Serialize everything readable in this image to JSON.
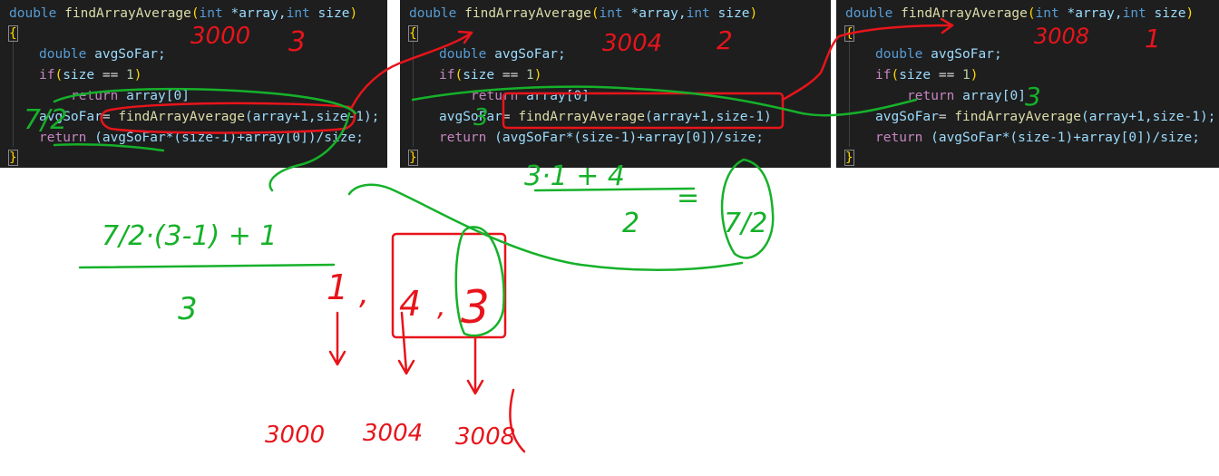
{
  "panels": [
    {
      "lines": {
        "signature": {
          "ret_type": "double",
          "fn_name": "findArrayAverage",
          "open_paren": "(",
          "p1_type": "int",
          "p1_name": " *array,",
          "p2_type": "int",
          "p2_name": " size",
          "close_paren": ")"
        },
        "open_brace": "{",
        "decl": {
          "type": "double",
          "name": " avgSoFar;"
        },
        "if_line": {
          "kw": "if",
          "open": "(",
          "var": "size",
          "op": " == ",
          "num": "1",
          "close": ")"
        },
        "return_base": {
          "kw": "return",
          "text": " array[0]"
        },
        "assign": {
          "lhs": "avgSoFar",
          "eq": "= ",
          "fn": "findArrayAverage",
          "args": "(array+1,size-1);"
        },
        "return_final": {
          "kw": "return",
          "text": " (avgSoFar*(size-1)+array[0])/size;"
        },
        "close_brace": "}"
      }
    },
    {
      "lines": {
        "signature": {
          "ret_type": "double",
          "fn_name": "findArrayAverage",
          "open_paren": "(",
          "p1_type": "int",
          "p1_name": " *array,",
          "p2_type": "int",
          "p2_name": " size",
          "close_paren": ")"
        },
        "open_brace": "{",
        "decl": {
          "type": "double",
          "name": " avgSoFar;"
        },
        "if_line": {
          "kw": "if",
          "open": "(",
          "var": "size",
          "op": " == ",
          "num": "1",
          "close": ")"
        },
        "return_base": {
          "kw": "return",
          "text": " array[0]"
        },
        "assign": {
          "lhs": "avgSoFar",
          "eq": "= ",
          "fn": "findArrayAverage",
          "args": "(array+1,size-1)"
        },
        "return_final": {
          "kw": "return",
          "text": " (avgSoFar*(size-1)+array[0])/size;"
        },
        "close_brace": "}"
      }
    },
    {
      "lines": {
        "signature": {
          "ret_type": "double",
          "fn_name": "findArrayAverage",
          "open_paren": "(",
          "p1_type": "int",
          "p1_name": " *array,",
          "p2_type": "int",
          "p2_name": " size",
          "close_paren": ")"
        },
        "open_brace": "{",
        "decl": {
          "type": "double",
          "name": " avgSoFar;"
        },
        "if_line": {
          "kw": "if",
          "open": "(",
          "var": "size",
          "op": " == ",
          "num": "1",
          "close": ")"
        },
        "return_base": {
          "kw": "return",
          "text": " array[0]"
        },
        "assign": {
          "lhs": "avgSoFar",
          "eq": "= ",
          "fn": "findArrayAverage",
          "args": "(array+1,size-1);"
        },
        "return_final": {
          "kw": "return",
          "text": " (avgSoFar*(size-1)+array[0])/size;"
        },
        "close_brace": "}"
      }
    }
  ],
  "annotations": {
    "colors": {
      "red": "#e8141b",
      "green": "#16b12a"
    },
    "panel1_address": "3000",
    "panel1_size": "3",
    "panel1_result": "7/2",
    "panel2_address": "3004",
    "panel2_size": "2",
    "panel2_result": "3",
    "panel3_address": "3008",
    "panel3_size": "1",
    "panel3_return": "3",
    "formula_left": {
      "num": "7/2·(3-1) + 1",
      "den": "3"
    },
    "formula_right": {
      "num": "3·1 + 4",
      "den": "2",
      "eq": "=",
      "result": "7/2"
    },
    "array_values": [
      "1",
      "4",
      "3"
    ],
    "array_separators": [
      ",",
      ","
    ],
    "addresses": [
      "3000",
      "3004",
      "3008"
    ]
  }
}
